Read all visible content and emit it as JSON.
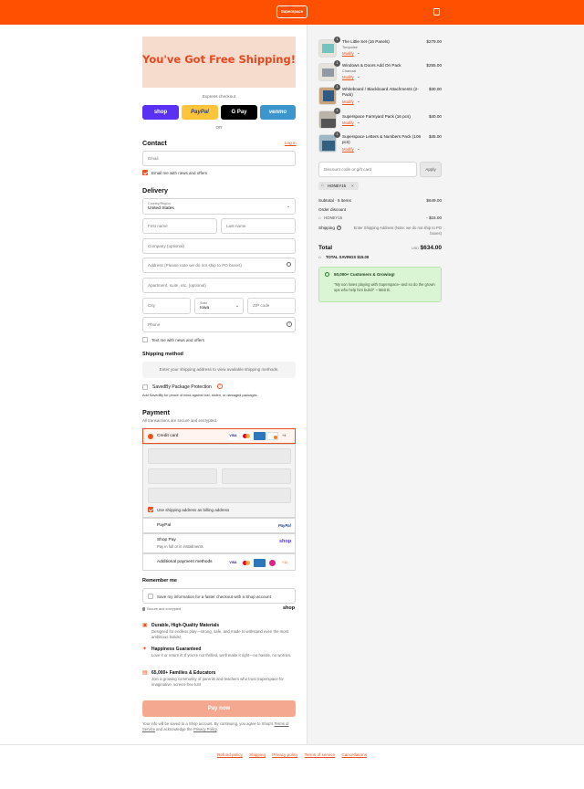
{
  "header": {
    "logo_text": "Superspace",
    "cart_icon": "bag-icon",
    "accent": "#fe5000"
  },
  "banner": {
    "text": "You've Got Free Shipping!"
  },
  "express": {
    "label": "Express checkout",
    "shop": "shop",
    "paypal": "PayPal",
    "gpay": "G Pay",
    "venmo": "venmo",
    "or": "OR"
  },
  "contact": {
    "title": "Contact",
    "login": "Log in",
    "email_placeholder": "Email",
    "email_news": "Email me with news and offers"
  },
  "delivery": {
    "title": "Delivery",
    "country_label": "Country/Region",
    "country_value": "United States",
    "first_name": "First name",
    "last_name": "Last name",
    "company": "Company (optional)",
    "address": "Address (Please note we do not ship to PO boxes)",
    "apartment": "Apartment, suite, etc. (optional)",
    "city": "City",
    "state_label": "State",
    "state_value": "Iowa",
    "zip": "ZIP code",
    "phone": "Phone",
    "text_news": "Text me with news and offers"
  },
  "shipping": {
    "title": "Shipping method",
    "placeholder": "Enter your shipping address to view available shipping methods.",
    "saved_by": "SavedBy Package Protection",
    "saved_by_desc": "Add SavedBy for peace of mind against lost, stolen, or damaged packages."
  },
  "payment": {
    "title": "Payment",
    "subtitle": "All transactions are secure and encrypted.",
    "credit_card": "Credit card",
    "billing_same": "Use shipping address as billing address",
    "paypal": "PayPal",
    "paypal_logo": "PayPal",
    "shop_pay": "Shop Pay",
    "shop_pay_desc": "Pay in full or in installments",
    "shop_logo": "shop",
    "additional": "Additional payment methods",
    "more_count": "+11",
    "card_more": "+4"
  },
  "remember": {
    "title": "Remember me",
    "save_info": "Save my information for a faster checkout with a Shop account",
    "secure": "Secure and encrypted",
    "shop_logo": "shop"
  },
  "features": [
    {
      "icon": "cube-icon",
      "title": "Durable, High-Quality Materials",
      "desc": "Designed for endless play—strong, safe, and made to withstand even the most ambitious builds!"
    },
    {
      "icon": "spark-icon",
      "title": "Happiness Guaranteed",
      "desc": "Love it or return it! If you're not thrilled, we'll make it right—no hassle, no worries."
    },
    {
      "icon": "users-icon",
      "title": "65,000+ Families & Educators",
      "desc": "Join a growing community of parents and teachers who trust Superspace for imaginative, screen-free fun!"
    }
  ],
  "pay_now": "Pay now",
  "terms": {
    "prefix": "Your info will be saved to a Shop account. By continuing, you agree to Shop's",
    "tos": "Terms of Service",
    "mid": "and acknowledge the",
    "privacy": "Privacy Policy",
    "end": "."
  },
  "footer": [
    "Refund policy",
    "Shipping",
    "Privacy policy",
    "Terms of service",
    "Cancellations"
  ],
  "cart": {
    "items": [
      {
        "qty": "1",
        "name": "The Little Set (16 Panels)",
        "variant": "Turquoise",
        "price": "$279.00",
        "modify": "Modify"
      },
      {
        "qty": "1",
        "name": "Windows & Doors Add On Pack",
        "variant": "Charcoal",
        "price": "$255.00",
        "modify": "Modify"
      },
      {
        "qty": "1",
        "name": "Whiteboard / Blackboard Attachments (2-Pack)",
        "variant": "",
        "price": "$30.00",
        "modify": "Modify"
      },
      {
        "qty": "1",
        "name": "Superspace Farmyard Pack (16 pcs)",
        "variant": "",
        "price": "$40.00",
        "modify": "Modify"
      },
      {
        "qty": "1",
        "name": "Superspace Letters & Numbers Pack (106 pcs)",
        "variant": "",
        "price": "$45.00",
        "modify": "Modify"
      }
    ],
    "discount_placeholder": "Discount code or gift card",
    "apply": "Apply",
    "code": "HONEY15",
    "subtotal_label": "Subtotal · 5 items",
    "subtotal": "$649.00",
    "order_discount": "Order discount",
    "discount_code": "HONEY15",
    "discount_value": "- $15.00",
    "shipping_label": "Shipping",
    "shipping_value": "Enter Shipping Address (Note: we do not ship to PO boxes)",
    "total_label": "Total",
    "currency": "USD",
    "total": "$634.00",
    "savings": "TOTAL SAVINGS  $15.00",
    "promo_title": "50,000+ Customers & Growing!",
    "promo_quote": "\"My son loves playing with Superspace--and so do the grown ups who help him build!\" ~ Matt B."
  }
}
